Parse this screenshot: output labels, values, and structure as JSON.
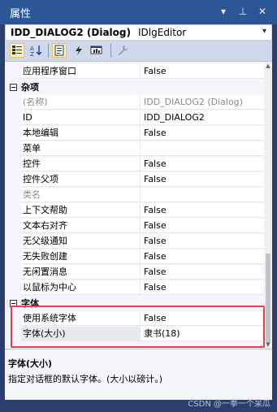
{
  "window": {
    "title": "属性"
  },
  "title_buttons": [
    {
      "name": "dropdown-icon",
      "glyph": "▾"
    },
    {
      "name": "pin-icon",
      "glyph": "⊥"
    },
    {
      "name": "close-icon",
      "glyph": "✕"
    }
  ],
  "object": {
    "name": "IDD_DIALOG2 (Dialog)",
    "type": "IDlgEditor",
    "dropdown_glyph": "▾"
  },
  "rows": [
    {
      "kind": "prop",
      "name": "应用程序窗口",
      "value": "False"
    },
    {
      "kind": "cat",
      "name": "杂项"
    },
    {
      "kind": "prop",
      "name": "(名称)",
      "value": "IDD_DIALOG2 (Dialog)",
      "dim": true
    },
    {
      "kind": "prop",
      "name": "ID",
      "value": "IDD_DIALOG2"
    },
    {
      "kind": "prop",
      "name": "本地编辑",
      "value": "False"
    },
    {
      "kind": "prop",
      "name": "菜单",
      "value": ""
    },
    {
      "kind": "prop",
      "name": "控件",
      "value": "False"
    },
    {
      "kind": "prop",
      "name": "控件父项",
      "value": "False"
    },
    {
      "kind": "prop",
      "name": "类名",
      "value": "",
      "dim": true
    },
    {
      "kind": "prop",
      "name": "上下文帮助",
      "value": "False"
    },
    {
      "kind": "prop",
      "name": "文本右对齐",
      "value": "False"
    },
    {
      "kind": "prop",
      "name": "无父级通知",
      "value": "False"
    },
    {
      "kind": "prop",
      "name": "无失败创建",
      "value": "False"
    },
    {
      "kind": "prop",
      "name": "无闲置消息",
      "value": "False"
    },
    {
      "kind": "prop",
      "name": "以鼠标为中心",
      "value": "False"
    },
    {
      "kind": "cat",
      "name": "字体"
    },
    {
      "kind": "prop",
      "name": "使用系统字体",
      "value": "False"
    },
    {
      "kind": "prop",
      "name": "字体(大小)",
      "value": "隶书(18)",
      "selected": true
    }
  ],
  "description": {
    "title": "字体(大小)",
    "text": "指定对话框的默认字体。(大小以磅计。)"
  },
  "watermark": "CSDN @一拳一个呆瓜",
  "colors": {
    "highlight_border": "#e8434a",
    "title_bar": "#2b5797",
    "frame": "#2b3f6e"
  }
}
